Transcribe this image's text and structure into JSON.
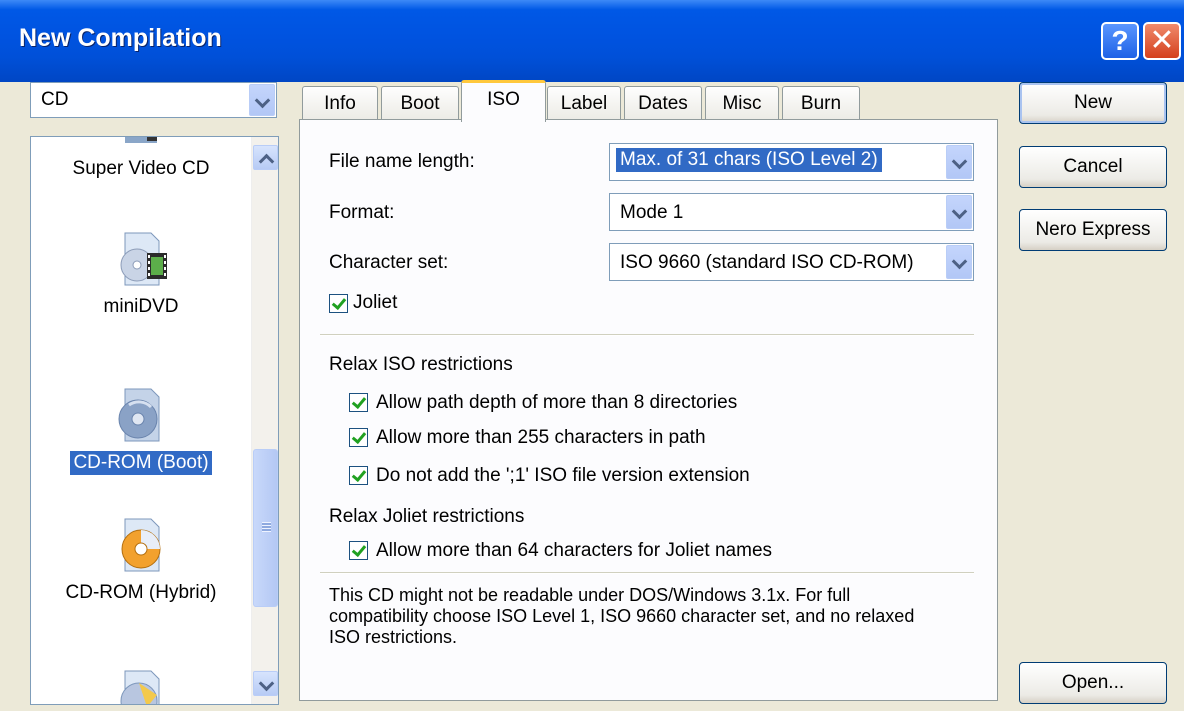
{
  "window": {
    "title": "New Compilation",
    "help_glyph": "?",
    "close_glyph": "✕"
  },
  "sidebar": {
    "type_combo": "CD",
    "items": [
      {
        "label": "Super Video CD",
        "icon": "super-video-cd-icon"
      },
      {
        "label": "miniDVD",
        "icon": "minidvd-icon"
      },
      {
        "label": "CD-ROM (Boot)",
        "icon": "cd-rom-boot-icon",
        "selected": true
      },
      {
        "label": "CD-ROM (Hybrid)",
        "icon": "cd-rom-hybrid-icon"
      }
    ]
  },
  "tabs": [
    "Info",
    "Boot",
    "ISO",
    "Label",
    "Dates",
    "Misc",
    "Burn"
  ],
  "active_tab": "ISO",
  "iso": {
    "file_name_length_label": "File name length:",
    "file_name_length_value": "Max. of 31 chars (ISO Level 2)",
    "format_label": "Format:",
    "format_value": "Mode 1",
    "charset_label": "Character set:",
    "charset_value": "ISO 9660 (standard ISO CD-ROM)",
    "joliet_label": "Joliet",
    "relax_iso_heading": "Relax ISO restrictions",
    "relax_iso_options": [
      "Allow path depth of more than 8 directories",
      "Allow more than 255 characters in path",
      "Do not add the ';1' ISO file version extension"
    ],
    "relax_joliet_heading": "Relax Joliet restrictions",
    "relax_joliet_option": "Allow more than 64 characters for Joliet names",
    "note": "This CD might not be readable under DOS/Windows 3.1x. For full compatibility choose ISO Level 1, ISO 9660 character set, and no relaxed ISO restrictions."
  },
  "buttons": {
    "new": "New",
    "cancel": "Cancel",
    "nero_express": "Nero Express",
    "open": "Open..."
  }
}
